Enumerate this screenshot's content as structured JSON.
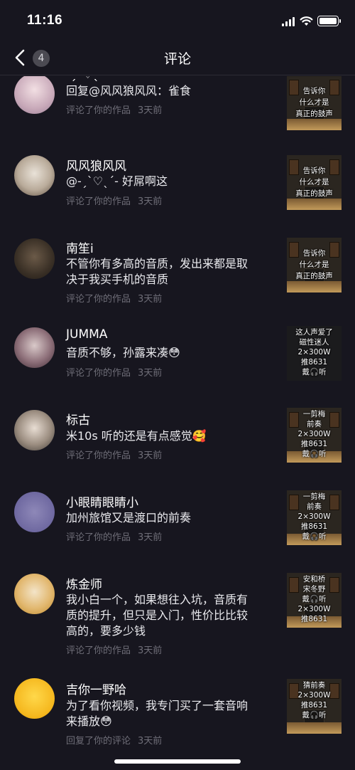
{
  "status": {
    "time": "11:16"
  },
  "nav": {
    "badge": "4",
    "title": "评论"
  },
  "items": [
    {
      "name": "-ˏˋ♡ˎˊ-",
      "text": "回复@风风狼风风：雀食",
      "action": "评论了你的作品",
      "time": "3天前",
      "thumb": "告诉你\n什么才是\n真正的鼓声"
    },
    {
      "name": "风风狼风风",
      "text": "@-ˏˋ♡ˎˊ- 好屌啊这",
      "action": "评论了你的作品",
      "time": "3天前",
      "thumb": "告诉你\n什么才是\n真正的鼓声"
    },
    {
      "name": "南笙i",
      "text": "不管你有多高的音质，发出来都是取决于我买手机的音质",
      "action": "评论了你的作品",
      "time": "3天前",
      "thumb": "告诉你\n什么才是\n真正的鼓声"
    },
    {
      "name": "JUMMA",
      "text": "音质不够，孙露来凑😳",
      "action": "评论了你的作品",
      "time": "3天前",
      "thumb": "这人声爱了\n磁性迷人\n2×300W\n推8631\n戴🎧听"
    },
    {
      "name": "标古",
      "text": "米10s 听的还是有点感觉🥰",
      "action": "评论了你的作品",
      "time": "3天前",
      "thumb": "一剪梅\n前奏\n2×300W\n推8631\n戴🎧听"
    },
    {
      "name": "小眼睛眼睛小",
      "text": "加州旅馆又是渡口的前奏",
      "action": "评论了你的作品",
      "time": "3天前",
      "thumb": "一剪梅\n前奏\n2×300W\n推8631\n戴🎧听"
    },
    {
      "name": "炼金师",
      "text": "我小白一个，如果想往入坑，音质有质的提升，但只是入门，性价比比较高的，要多少钱",
      "action": "评论了你的作品",
      "time": "3天前",
      "thumb": "安和桥\n宋冬野\n戴🎧听\n2×300W\n推8631"
    },
    {
      "name": "吉你一野哈",
      "text": "为了看你视频，我专门买了一套音响来播放😳",
      "action": "回复了你的评论",
      "time": "3天前",
      "thumb": "猜前奏\n2×300W\n推8631\n戴🎧听"
    }
  ]
}
